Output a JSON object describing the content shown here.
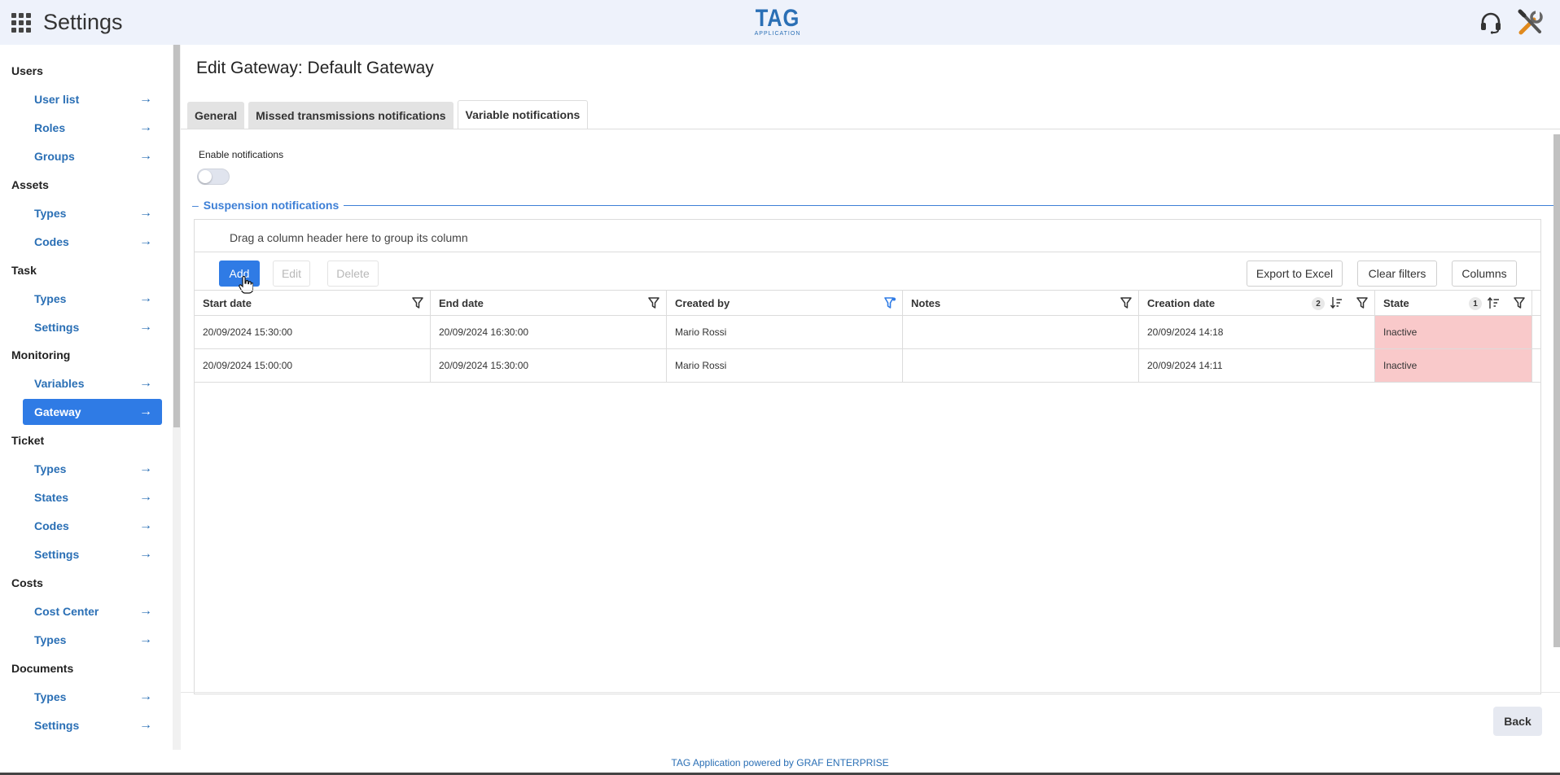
{
  "header": {
    "title": "Settings",
    "logo_main": "TAG",
    "logo_sub": "APPLICATION"
  },
  "sidebar": {
    "sections": [
      {
        "title": "Users",
        "items": [
          "User list",
          "Roles",
          "Groups"
        ]
      },
      {
        "title": "Assets",
        "items": [
          "Types",
          "Codes"
        ]
      },
      {
        "title": "Task",
        "items": [
          "Types",
          "Settings"
        ]
      },
      {
        "title": "Monitoring",
        "items": [
          "Variables",
          "Gateway"
        ]
      },
      {
        "title": "Ticket",
        "items": [
          "Types",
          "States",
          "Codes",
          "Settings"
        ]
      },
      {
        "title": "Costs",
        "items": [
          "Cost Center",
          "Types"
        ]
      },
      {
        "title": "Documents",
        "items": [
          "Types",
          "Settings"
        ]
      }
    ],
    "active_item": "Gateway",
    "arrow": "→"
  },
  "page": {
    "title": "Edit Gateway: Default Gateway"
  },
  "tabs": [
    "General",
    "Missed transmissions notifications",
    "Variable notifications"
  ],
  "active_tab": "Variable notifications",
  "form": {
    "enable_label": "Enable notifications",
    "enabled": false,
    "legend_dash": "–",
    "legend": "Suspension notifications"
  },
  "grid": {
    "group_panel": "Drag a column header here to group its column",
    "toolbar": {
      "add": "Add",
      "edit": "Edit",
      "delete": "Delete",
      "export": "Export to Excel",
      "clear": "Clear filters",
      "columns": "Columns"
    },
    "columns": [
      "Start date",
      "End date",
      "Created by",
      "Notes",
      "Creation date",
      "State"
    ],
    "sort_badges": {
      "creation_date": "2",
      "state": "1"
    },
    "rows": [
      [
        "20/09/2024 15:30:00",
        "20/09/2024 16:30:00",
        "Mario Rossi",
        "",
        "20/09/2024 14:18",
        "Inactive"
      ],
      [
        "20/09/2024 15:00:00",
        "20/09/2024 15:30:00",
        "Mario Rossi",
        "",
        "20/09/2024 14:11",
        "Inactive"
      ]
    ]
  },
  "back_label": "Back",
  "footer": "TAG Application powered by GRAF ENTERPRISE",
  "colors": {
    "accent": "#2f7be5",
    "link": "#2a6fb5",
    "inactive_bg": "#f9c9ca",
    "header_bg": "#eef2fb"
  }
}
